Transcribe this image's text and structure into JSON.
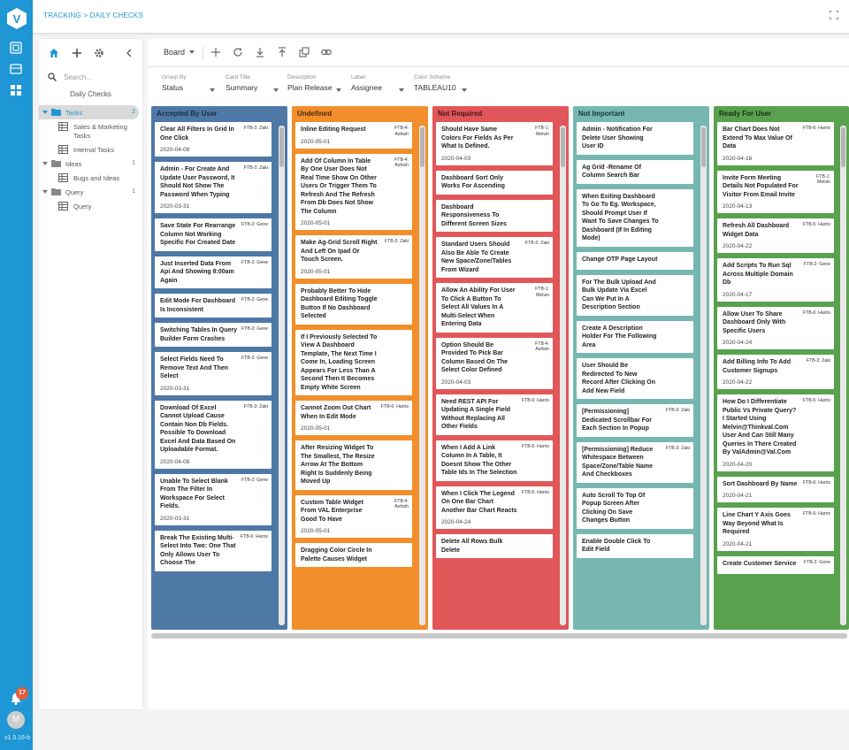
{
  "app": {
    "logo_letter": "V",
    "version": "v1.5.16-b",
    "notifications_count": "17",
    "user_initial": "M",
    "accent_color": "#1f97d4"
  },
  "topbar": {
    "breadcrumb": "TRACKING > DAILY CHECKS",
    "fullscreen_icon": "expand-icon"
  },
  "sidebar": {
    "search_placeholder": "Search...",
    "board_name": "Daily Checks",
    "tree": [
      {
        "label": "Tasks",
        "count": "2",
        "selected": true,
        "children": [
          "Sales & Marketing Tasks",
          "Internal Tasks"
        ]
      },
      {
        "label": "Ideas",
        "count": "1",
        "selected": false,
        "children": [
          "Bugs and Ideas"
        ]
      },
      {
        "label": "Query",
        "count": "1",
        "selected": false,
        "children": [
          "Query"
        ]
      }
    ]
  },
  "toolbar": {
    "board_label": "Board"
  },
  "filters": {
    "group_by": {
      "label": "Group By",
      "value": "Status"
    },
    "card_title": {
      "label": "Card Title",
      "value": "Summary"
    },
    "description": {
      "label": "Description",
      "value": "Plan Release"
    },
    "label": {
      "label": "Label",
      "value": "Assignee"
    },
    "color_scheme": {
      "label": "Color Scheme",
      "value": "TABLEAU10"
    }
  },
  "columns": [
    {
      "title": "Accepted By User",
      "color": "#4e79a7",
      "head_text": "#1b2c45",
      "cards": [
        {
          "title": "Clear All Filters In Grid In One Click",
          "label": "FTB-3: Zaki",
          "date": "2020-04-08"
        },
        {
          "title": "Admin - For Create And Update User Password, It Should Not Show The Password When Typing",
          "label": "FTB-3: Zaki",
          "date": "2020-03-31"
        },
        {
          "title": "Save State For Rearrange Column Not Working Specific For Created Date",
          "label": "FTB-2: Gene",
          "date": ""
        },
        {
          "title": "Just Inserted Data From Api And Showing 8:00am Again",
          "label": "FTB-2: Gene",
          "date": ""
        },
        {
          "title": "Edit Mode For Dashboard Is Inconsistent",
          "label": "FTB-2: Gene",
          "date": ""
        },
        {
          "title": "Switching Tables In Query Builder Form Crashes",
          "label": "FTB-2: Gene",
          "date": ""
        },
        {
          "title": "Select Fields Need To Remove Text And Then Select",
          "label": "FTB-2: Gene",
          "date": "2020-03-31"
        },
        {
          "title": "Download Of Excel Cannot Upload Cause Contain Non Db Fields. Possible To Download Excel And Data Based On Uploadable Format.",
          "label": "FTB-3: Zaki",
          "date": "2020-04-08"
        },
        {
          "title": "Unable To Select Blank From The Filter In Workspace For Select Fields.",
          "label": "FTB-2: Gene",
          "date": "2020-03-31"
        },
        {
          "title": "Break The Existing Multi-Select Into Two: One That Only Allows User To Choose The",
          "label": "FTB-6: Harris",
          "date": ""
        }
      ]
    },
    {
      "title": "Undefined",
      "color": "#f28e2b",
      "head_text": "#4a2a08",
      "cards": [
        {
          "title": "Inline Editing Request",
          "label": "FTB-4: Ashish",
          "date": "2020-05-01"
        },
        {
          "title": "Add Of Column In Table By One User Does Not Real Time Show On Other Users Or Trigger Them To Refresh And The Refresh From Db Does Not Show The Column",
          "label": "FTB-4: Ashish",
          "date": "2020-05-01"
        },
        {
          "title": "Make Ag-Grid Scroll Right And Left On Ipad Or Touch Screen.",
          "label": "FTB-3: Zaki",
          "date": "2020-05-01"
        },
        {
          "title": "Probably Better To Hide Dashboard Editing Toggle Button If No Dashboard Selected",
          "label": "",
          "date": ""
        },
        {
          "title": "If I Previously Selected To View A Dashboard Template, The Next Time I Come In, Loading Screen Appears For Less Than A Second Then It Becomes Empty White Screen",
          "label": "",
          "date": ""
        },
        {
          "title": "Cannot Zoom Out Chart When In Edit Mode",
          "label": "FTB-6: Harris",
          "date": "2020-05-01"
        },
        {
          "title": "After Resizing Widget To The Smallest, The Resize Arrow At The Bottom Right Is Suddenly Being Moved Up",
          "label": "",
          "date": ""
        },
        {
          "title": "Custom Table Widget From VAL Enterprise Good To Have",
          "label": "FTB-4: Ashish",
          "date": "2020-05-01"
        },
        {
          "title": "Dragging Color Circle In Palette Causes Widget",
          "label": "",
          "date": ""
        }
      ]
    },
    {
      "title": "Not Required",
      "color": "#e15759",
      "head_text": "#4b1213",
      "cards": [
        {
          "title": "Should Have Same Colors For Fields As Per What Is Defined.",
          "label": "FTB-1: Melvin",
          "date": "2020-04-03"
        },
        {
          "title": "Dashboard Sort Only Works For Ascending",
          "label": "",
          "date": ""
        },
        {
          "title": "Dashboard Responsiveness To Different Screen Sizes",
          "label": "",
          "date": ""
        },
        {
          "title": "Standard Users Should Also Be Able To Create New Space/Zone/Tables From Wizard",
          "label": "FTB-3: Zaki",
          "date": ""
        },
        {
          "title": "Allow An Ability For User To Click A Button To Select All Values In A Multi-Select When Entering Data",
          "label": "FTB-1: Melvin",
          "date": ""
        },
        {
          "title": "Option Should Be Provided To Pick Bar Column Based On The Select Color Defined",
          "label": "FTB-4: Ashish",
          "date": "2020-04-03"
        },
        {
          "title": "Need REST API For Updating A Single Field Without Replacing All Other Fields",
          "label": "FTB-6: Harris",
          "date": ""
        },
        {
          "title": "When I Add A Link Column In A Table, It Doesnt Show The Other Table Ids In The Selection",
          "label": "FTB-6: Harris",
          "date": ""
        },
        {
          "title": "When I Click The Legend On One Bar Chart Another Bar Chart Reacts",
          "label": "FTB-6: Harris",
          "date": "2020-04-24"
        },
        {
          "title": "Delete All Rows Bulk Delete",
          "label": "",
          "date": ""
        }
      ]
    },
    {
      "title": "Not Important",
      "color": "#76b7b2",
      "head_text": "#173533",
      "cards": [
        {
          "title": "Admin - Notification For Delete User Showing User ID",
          "label": "",
          "date": ""
        },
        {
          "title": "Ag Grid -Rename Of Column Search Bar",
          "label": "",
          "date": ""
        },
        {
          "title": "When Exiting Dashboard To Go To Eg. Workspace, Should Prompt User If Want To Save Changes To Dashboard (If In Editing Mode)",
          "label": "",
          "date": ""
        },
        {
          "title": "Change OTP Page Layout",
          "label": "",
          "date": ""
        },
        {
          "title": "For The Bulk Upload And Bulk Update Via Excel Can We Put In A Description Section",
          "label": "",
          "date": ""
        },
        {
          "title": "Create A Description Holder For The Following Area",
          "label": "",
          "date": ""
        },
        {
          "title": "User Should Be Redirected To New Record After Clicking On Add New Field",
          "label": "",
          "date": ""
        },
        {
          "title": "[Permissioning] Dedicated Scrollbar For Each Section In Popup",
          "label": "FTB-3: Zaki",
          "date": ""
        },
        {
          "title": "[Permissioning] Reduce Whitespace Between Space/Zone/Table Name And Checkboxes",
          "label": "FTB-3: Zaki",
          "date": ""
        },
        {
          "title": "Auto Scroll To Top Of Popup Screen After Clicking On Save Changes Button",
          "label": "",
          "date": ""
        },
        {
          "title": "Enable Double Click To Edit Field",
          "label": "",
          "date": ""
        }
      ]
    },
    {
      "title": "Ready For User",
      "color": "#59a14f",
      "head_text": "#143012",
      "cards": [
        {
          "title": "Bar Chart Does Not Extend To Max Value Of Data",
          "label": "FTB-6: Harris",
          "date": "2020-04-16"
        },
        {
          "title": "Invite Form Meeting Details Not Populated For Visitor From Email Invite",
          "label": "FTB-1: Melvin",
          "date": "2020-04-13"
        },
        {
          "title": "Refresh All Dashboard Widget Data",
          "label": "FTB-6: Harris",
          "date": "2020-04-22"
        },
        {
          "title": "Add Scripts To Run Sql Across Multiple Domain Db",
          "label": "FTB-2: Gene",
          "date": "2020-04-17"
        },
        {
          "title": "Allow User To Share Dashboard Only With Specific Users",
          "label": "FTB-6: Harris",
          "date": "2020-04-24"
        },
        {
          "title": "Add Billing Info To Add Customer Signups",
          "label": "FTB-3: Zaki",
          "date": "2020-04-22"
        },
        {
          "title": "How Do I Differentiate Public Vs Private Query? I Started Using Melvin@Thinkval.Com User And Can Still Many Queries In There Created By ValAdmin@Val.Com",
          "label": "FTB-6: Harris",
          "date": "2020-04-20"
        },
        {
          "title": "Sort Dashboard By Name",
          "label": "FTB-6: Harris",
          "date": "2020-04-21"
        },
        {
          "title": "Line Chart Y Axis Goes Way Beyond What Is Required",
          "label": "FTB-6: Harris",
          "date": "2020-04-21"
        },
        {
          "title": "Create Customer Service",
          "label": "FTB-2: Gene",
          "date": ""
        }
      ]
    }
  ]
}
